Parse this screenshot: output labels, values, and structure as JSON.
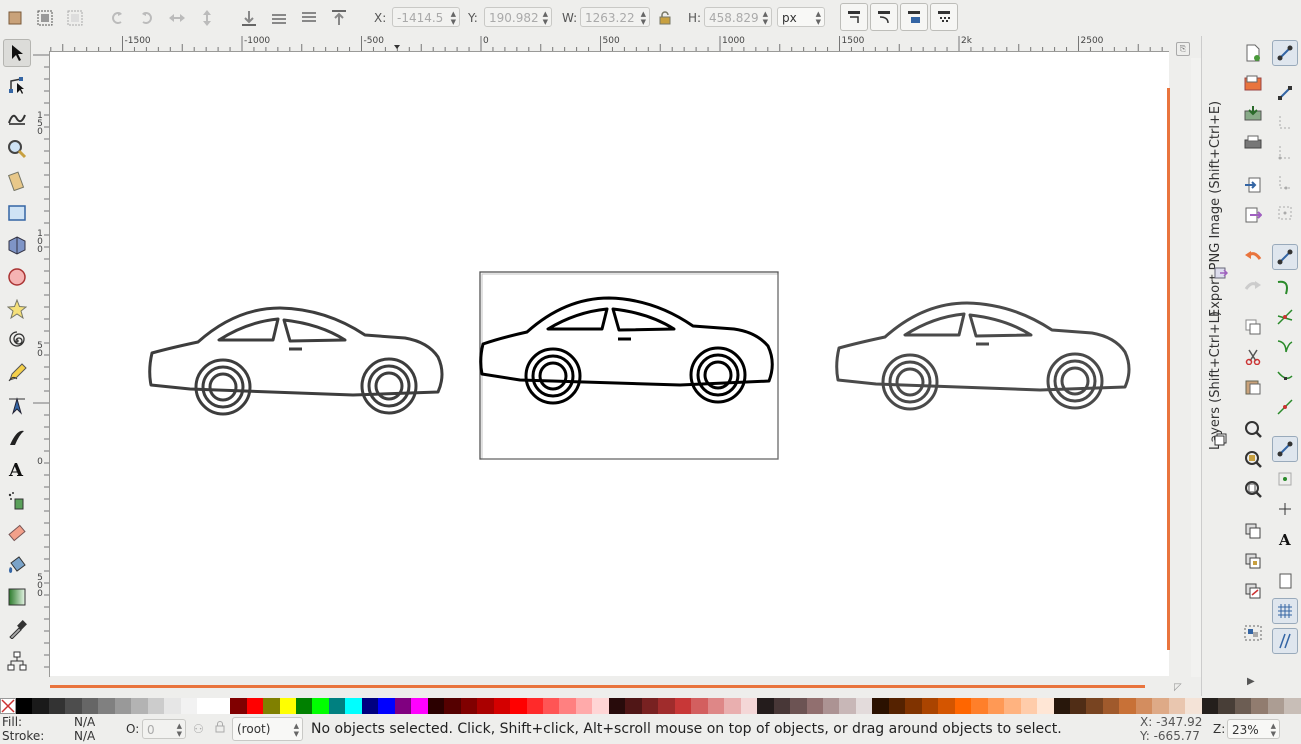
{
  "toolbar": {
    "x_label": "X:",
    "x_value": "-1414.5",
    "y_label": "Y:",
    "y_value": "190.982",
    "w_label": "W:",
    "w_value": "1263.22",
    "h_label": "H:",
    "h_value": "458.829",
    "unit": "px",
    "icons": [
      "select-all-icon",
      "select-all-in-layers-icon",
      "deselect-icon",
      "rotate-ccw-icon",
      "rotate-cw-icon",
      "flip-horizontal-icon",
      "flip-vertical-icon",
      "lower-to-bottom-icon",
      "lower-icon",
      "raise-icon",
      "raise-to-top-icon",
      "lock-icon"
    ]
  },
  "hruler": {
    "labels": [
      "-1500",
      "-1000",
      "-500",
      "0",
      "500",
      "1000",
      "1500",
      "2k",
      "2500"
    ]
  },
  "vruler": {
    "labels": [
      "150",
      "100",
      "50",
      "0",
      "500"
    ]
  },
  "dock": {
    "tab_export": "Export PNG Image (Shift+Ctrl+E)",
    "tab_layers": "Layers (Shift+Ctrl+L)"
  },
  "status": {
    "fill_label": "Fill:",
    "fill_value": "N/A",
    "stroke_label": "Stroke:",
    "stroke_value": "N/A",
    "opacity_label": "O:",
    "opacity_value": "0",
    "layer": "(root)",
    "message": "No objects selected. Click, Shift+click, Alt+scroll mouse on top of objects, or drag around objects to select.",
    "cursor_x": "X: -347.92",
    "cursor_y": "Y: -665.77",
    "zoom_label": "Z:",
    "zoom_value": "23%"
  },
  "palette": [
    "#000000",
    "#1a1a1a",
    "#333333",
    "#4d4d4d",
    "#666666",
    "#808080",
    "#999999",
    "#b3b3b3",
    "#cccccc",
    "#e6e6e6",
    "#f2f2f2",
    "#ffffff",
    "#ffffff",
    "#800000",
    "#ff0000",
    "#808000",
    "#ffff00",
    "#008000",
    "#00ff00",
    "#008080",
    "#00ffff",
    "#000080",
    "#0000ff",
    "#800080",
    "#ff00ff",
    "#2b0000",
    "#550000",
    "#800000",
    "#aa0000",
    "#d40000",
    "#ff0000",
    "#ff2a2a",
    "#ff5555",
    "#ff8080",
    "#ffaaaa",
    "#ffd5d5",
    "#280b0b",
    "#501616",
    "#782121",
    "#a02c2c",
    "#c83737",
    "#d35f5f",
    "#de8787",
    "#e9afaf",
    "#f4d7d7",
    "#241c1c",
    "#483737",
    "#6c5353",
    "#916f6f",
    "#ac9393",
    "#c8b7b7",
    "#e3dbdb",
    "#2b1100",
    "#552200",
    "#803300",
    "#aa4400",
    "#d45500",
    "#ff6600",
    "#ff7f2a",
    "#ff9955",
    "#ffb380",
    "#ffccaa",
    "#ffe6d5",
    "#28170b",
    "#502d16",
    "#784421",
    "#a05a2c",
    "#c87137",
    "#d38d5f",
    "#deaa87",
    "#e9c6af",
    "#f4e3d7",
    "#241f1c",
    "#483e37",
    "#6c5d53",
    "#917c6f",
    "#ac9d93",
    "#c8beb7"
  ],
  "colors": {
    "accent": "#e9743d",
    "selection_border": "#555555"
  }
}
